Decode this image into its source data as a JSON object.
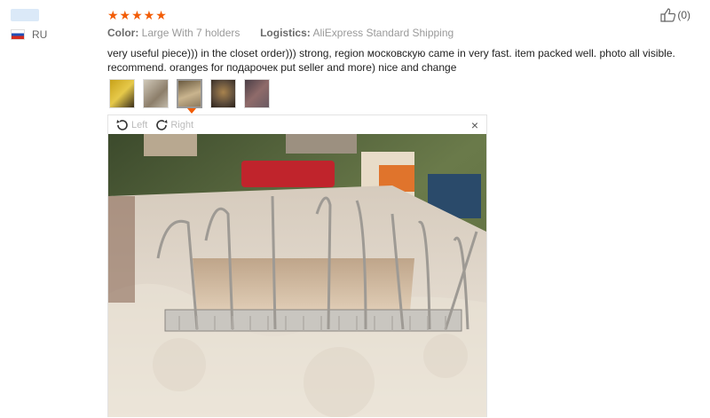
{
  "user": {
    "country": "RU"
  },
  "review": {
    "stars": "★★★★★",
    "color_label": "Color:",
    "color_value": "Large With 7 holders",
    "logistics_label": "Logistics:",
    "logistics_value": "AliExpress Standard Shipping",
    "text": "very useful piece))) in the closet order))) strong, region московскую came in very fast. item packed well. photo all visible. recommend. oranges for подарочек put seller and more) nice and change",
    "likes": "(0)"
  },
  "viewer": {
    "rotate_left": "Left",
    "rotate_right": "Right",
    "close": "×"
  },
  "thumbnails": [
    {
      "colors": [
        "#c8a21a",
        "#e6c94a"
      ]
    },
    {
      "colors": [
        "#c0b8a8",
        "#8c7e6a"
      ]
    },
    {
      "colors": [
        "#8c7a5e",
        "#c9b48e"
      ]
    },
    {
      "colors": [
        "#5a4a3a",
        "#a8834e"
      ]
    },
    {
      "colors": [
        "#6a5a62",
        "#8f6b6a"
      ]
    }
  ],
  "colors": {
    "accent": "#f25c05",
    "meta_gray": "#9a9a9a"
  }
}
